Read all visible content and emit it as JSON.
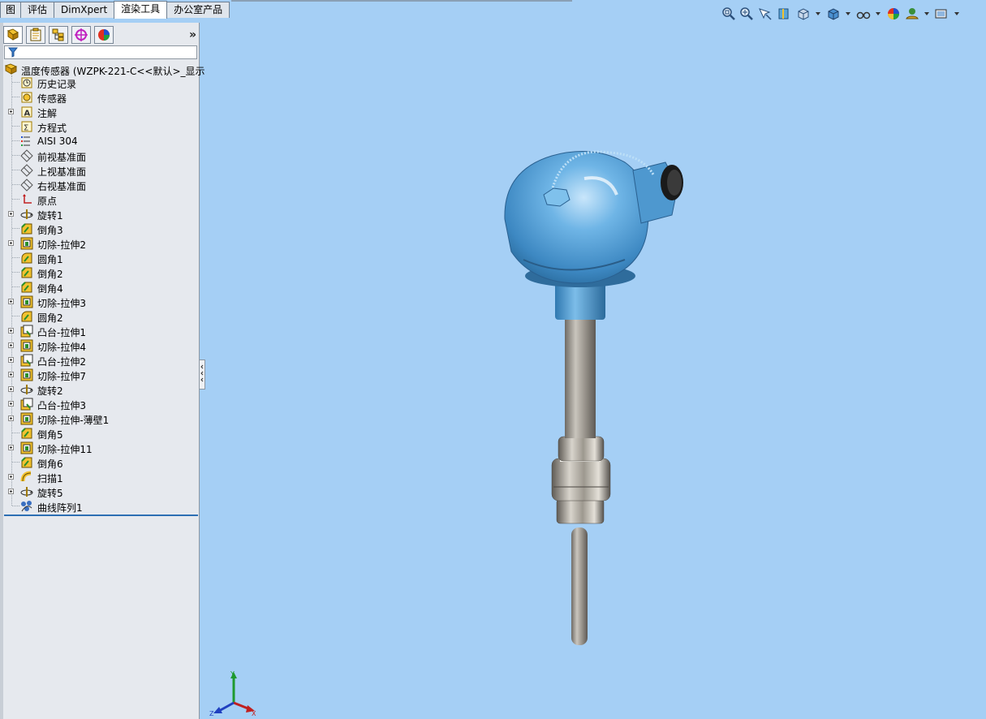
{
  "tabs": [
    {
      "label": "图",
      "active": false
    },
    {
      "label": "评估",
      "active": false
    },
    {
      "label": "DimXpert",
      "active": false
    },
    {
      "label": "渲染工具",
      "active": true
    },
    {
      "label": "办公室产品",
      "active": false
    }
  ],
  "panel": {
    "tab_icons": [
      "feature-manager-icon",
      "property-manager-icon",
      "configuration-manager-icon",
      "dimxpert-manager-icon",
      "display-manager-icon"
    ],
    "expand_label": "»"
  },
  "tree": {
    "root": "温度传感器  (WZPK-221-C<<默认>_显示",
    "items": [
      {
        "label": "历史记录",
        "icon": "history-icon",
        "expand": false
      },
      {
        "label": "传感器",
        "icon": "sensor-icon",
        "expand": false
      },
      {
        "label": "注解",
        "icon": "annotation-icon",
        "expand": true
      },
      {
        "label": "方程式",
        "icon": "equation-icon",
        "expand": false
      },
      {
        "label": "AISI 304",
        "icon": "material-icon",
        "expand": false
      },
      {
        "label": "前视基准面",
        "icon": "plane-icon",
        "expand": false
      },
      {
        "label": "上视基准面",
        "icon": "plane-icon",
        "expand": false
      },
      {
        "label": "右视基准面",
        "icon": "plane-icon",
        "expand": false
      },
      {
        "label": "原点",
        "icon": "origin-icon",
        "expand": false
      },
      {
        "label": "旋转1",
        "icon": "revolve-icon",
        "expand": true
      },
      {
        "label": "倒角3",
        "icon": "chamfer-icon",
        "expand": false
      },
      {
        "label": "切除-拉伸2",
        "icon": "cut-extrude-icon",
        "expand": true
      },
      {
        "label": "圆角1",
        "icon": "fillet-icon",
        "expand": false
      },
      {
        "label": "倒角2",
        "icon": "chamfer-icon",
        "expand": false
      },
      {
        "label": "倒角4",
        "icon": "chamfer-icon",
        "expand": false
      },
      {
        "label": "切除-拉伸3",
        "icon": "cut-extrude-icon",
        "expand": true
      },
      {
        "label": "圆角2",
        "icon": "fillet-icon",
        "expand": false
      },
      {
        "label": "凸台-拉伸1",
        "icon": "boss-extrude-icon",
        "expand": true
      },
      {
        "label": "切除-拉伸4",
        "icon": "cut-extrude-icon",
        "expand": true
      },
      {
        "label": "凸台-拉伸2",
        "icon": "boss-extrude-icon",
        "expand": true
      },
      {
        "label": "切除-拉伸7",
        "icon": "cut-extrude-icon",
        "expand": true
      },
      {
        "label": "旋转2",
        "icon": "revolve-icon",
        "expand": true
      },
      {
        "label": "凸台-拉伸3",
        "icon": "boss-extrude-icon",
        "expand": true
      },
      {
        "label": "切除-拉伸-薄壁1",
        "icon": "cut-extrude-icon",
        "expand": true
      },
      {
        "label": "倒角5",
        "icon": "chamfer-icon",
        "expand": false
      },
      {
        "label": "切除-拉伸11",
        "icon": "cut-extrude-icon",
        "expand": true
      },
      {
        "label": "倒角6",
        "icon": "chamfer-icon",
        "expand": false
      },
      {
        "label": "扫描1",
        "icon": "sweep-icon",
        "expand": true
      },
      {
        "label": "旋转5",
        "icon": "revolve-icon",
        "expand": true
      },
      {
        "label": "曲线阵列1",
        "icon": "curve-pattern-icon",
        "expand": false
      }
    ]
  },
  "hud": {
    "icons": [
      "zoom-to-fit-icon",
      "zoom-to-area-icon",
      "previous-view-icon",
      "section-view-icon",
      "view-orientation-icon",
      "display-style-icon",
      "hide-show-items-icon",
      "edit-appearance-icon",
      "apply-scene-icon",
      "view-settings-icon"
    ]
  },
  "triad": {
    "x": "X",
    "y": "Y",
    "z": "Z"
  },
  "colors": {
    "viewport": "#a5cff5",
    "housing": "#5aa6da",
    "stem": "#8f8b84",
    "panel": "#e6e9ee"
  }
}
